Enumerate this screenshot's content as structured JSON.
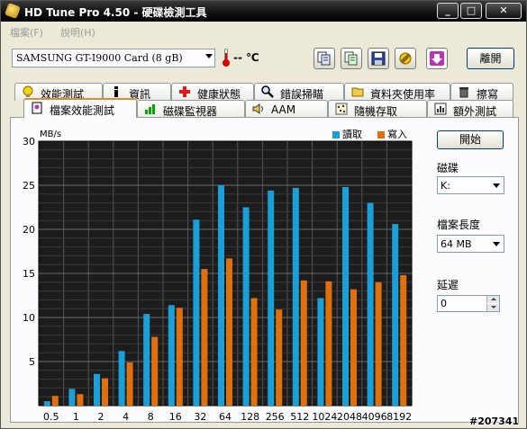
{
  "window": {
    "title": "HD Tune Pro 4.50 - 硬碟檢測工具",
    "minimize": "_",
    "maximize": "□",
    "close": "✕"
  },
  "menu": {
    "file": "檔案(F)",
    "help": "說明(H)"
  },
  "toolbar": {
    "drive": "SAMSUNG GT-I9000 Card    (8 gB)",
    "temperature": "-- ℃",
    "exit_label": "離開"
  },
  "tabs_top": [
    {
      "label": "效能測試",
      "icon": "info-bulb-icon"
    },
    {
      "label": "資訊",
      "icon": "info-icon"
    },
    {
      "label": "健康狀態",
      "icon": "health-cross-icon"
    },
    {
      "label": "錯誤掃瞄",
      "icon": "magnifier-icon"
    },
    {
      "label": "資料夾使用率",
      "icon": "folder-icon"
    },
    {
      "label": "擦寫",
      "icon": "trash-icon"
    }
  ],
  "tabs_bottom": [
    {
      "label": "檔案效能測試",
      "icon": "file-benchmark-icon",
      "active": true
    },
    {
      "label": "磁碟監視器",
      "icon": "monitor-bars-icon"
    },
    {
      "label": "AAM",
      "icon": "speaker-icon"
    },
    {
      "label": "隨機存取",
      "icon": "random-dots-icon"
    },
    {
      "label": "額外測試",
      "icon": "extra-test-icon"
    }
  ],
  "controls": {
    "start_label": "開始",
    "disk_label": "磁碟",
    "disk_value": "K:",
    "file_length_label": "檔案長度",
    "file_length_value": "64 MB",
    "delay_label": "延遲",
    "delay_value": "0"
  },
  "colors": {
    "read": "#1aa0d8",
    "write": "#e0700e",
    "plot_bg": "#1c1c1c",
    "grid": "#555555"
  },
  "chart_data": {
    "type": "bar",
    "ylabel": "MB/s",
    "ylim": [
      0,
      30
    ],
    "yticks": [
      5,
      10,
      15,
      20,
      25,
      30
    ],
    "categories": [
      "0.5",
      "1",
      "2",
      "4",
      "8",
      "16",
      "32",
      "64",
      "128",
      "256",
      "512",
      "1024",
      "2048",
      "4096",
      "8192"
    ],
    "series": [
      {
        "name": "讀取",
        "values": [
          0.5,
          1.9,
          3.6,
          6.2,
          10.4,
          11.4,
          21.1,
          25.0,
          22.5,
          24.4,
          24.7,
          12.2,
          24.8,
          23.0,
          20.6
        ]
      },
      {
        "name": "寫入",
        "values": [
          1.1,
          1.3,
          3.1,
          4.9,
          7.8,
          11.1,
          15.5,
          16.7,
          12.2,
          10.9,
          14.2,
          14.1,
          13.2,
          14.0,
          14.8
        ]
      }
    ],
    "grid": true,
    "legend": "top-right"
  },
  "watermark": "#207341"
}
